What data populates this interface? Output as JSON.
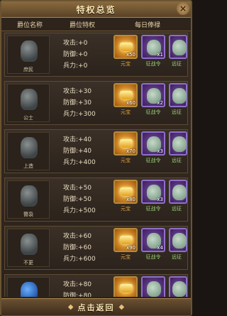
{
  "title": "特权总览",
  "headers": {
    "rank_name": "爵位名称",
    "privilege": "爵位特权",
    "daily_salary": "每日俸禄"
  },
  "rows": [
    {
      "name": "庶民",
      "attack": "攻击:+0",
      "defense": "防御:+0",
      "troops": "兵力:+0",
      "gold_qty": "x50",
      "bag1_qty": "x1",
      "gold_label": "元宝",
      "bag1_label": "征战令",
      "bag2_label": "远征"
    },
    {
      "name": "公士",
      "attack": "攻击:+30",
      "defense": "防御:+30",
      "troops": "兵力:+300",
      "gold_qty": "x60",
      "bag1_qty": "x2",
      "gold_label": "元宝",
      "bag1_label": "征战令",
      "bag2_label": "远征"
    },
    {
      "name": "上造",
      "attack": "攻击:+40",
      "defense": "防御:+40",
      "troops": "兵力:+400",
      "gold_qty": "x70",
      "bag1_qty": "x3",
      "gold_label": "元宝",
      "bag1_label": "征战令",
      "bag2_label": "远征"
    },
    {
      "name": "簪袅",
      "attack": "攻击:+50",
      "defense": "防御:+50",
      "troops": "兵力:+500",
      "gold_qty": "x80",
      "bag1_qty": "x3",
      "gold_label": "元宝",
      "bag1_label": "征战令",
      "bag2_label": "远征"
    },
    {
      "name": "不更",
      "attack": "攻击:+60",
      "defense": "防御:+60",
      "troops": "兵力:+600",
      "gold_qty": "x90",
      "bag1_qty": "x4",
      "gold_label": "元宝",
      "bag1_label": "征战令",
      "bag2_label": "远征"
    },
    {
      "name": "",
      "attack": "攻击:+80",
      "defense": "防御:+80",
      "troops": "",
      "gold_qty": "",
      "bag1_qty": "",
      "gold_label": "",
      "bag1_label": "",
      "bag2_label": ""
    }
  ],
  "back_label": "点击返回"
}
